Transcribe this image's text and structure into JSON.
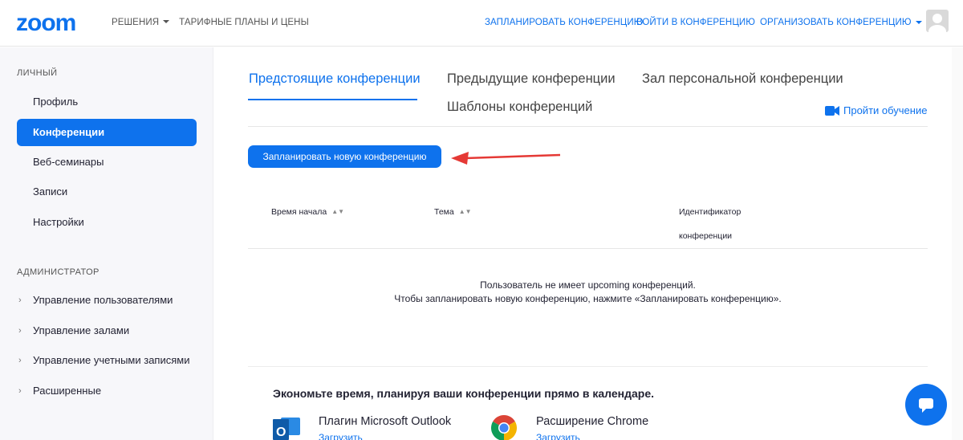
{
  "header": {
    "logo_text": "zoom",
    "nav_left": {
      "solutions": "РЕШЕНИЯ",
      "plans": "ТАРИФНЫЕ ПЛАНЫ И ЦЕНЫ"
    },
    "nav_right": {
      "schedule": "ЗАПЛАНИРОВАТЬ КОНФЕРЕНЦИЮ",
      "join": "ВОЙТИ В КОНФЕРЕНЦИЮ",
      "host": "ОРГАНИЗОВАТЬ КОНФЕРЕНЦИЮ"
    }
  },
  "sidebar": {
    "personal_label": "ЛИЧНЫЙ",
    "personal_items": [
      "Профиль",
      "Конференции",
      "Веб-семинары",
      "Записи",
      "Настройки"
    ],
    "admin_label": "АДМИНИСТРАТОР",
    "admin_items": [
      "Управление пользователями",
      "Управление залами",
      "Управление учетными записями",
      "Расширенные"
    ]
  },
  "tabs": {
    "upcoming": "Предстоящие конференции",
    "previous": "Предыдущие конференции",
    "personal_room": "Зал персональной конференции",
    "templates": "Шаблоны конференций"
  },
  "training_link": "Пройти обучение",
  "schedule_button": "Запланировать новую конференцию",
  "table": {
    "col_time": "Время начала",
    "col_topic": "Тема",
    "col_id_line1": "Идентификатор",
    "col_id_line2": "конференции"
  },
  "empty_state": {
    "line1": "Пользователь не имеет upcoming конференций.",
    "line2": "Чтобы запланировать новую конференцию, нажмите «Запланировать конференцию»."
  },
  "promo": {
    "title": "Экономьте время, планируя ваши конференции прямо в календаре.",
    "outlook_name": "Плагин Microsoft Outlook",
    "outlook_link": "Загрузить",
    "chrome_name": "Расширение Chrome",
    "chrome_link": "Загрузить"
  },
  "colors": {
    "accent": "#0e72ed",
    "arrow": "#e53935"
  }
}
